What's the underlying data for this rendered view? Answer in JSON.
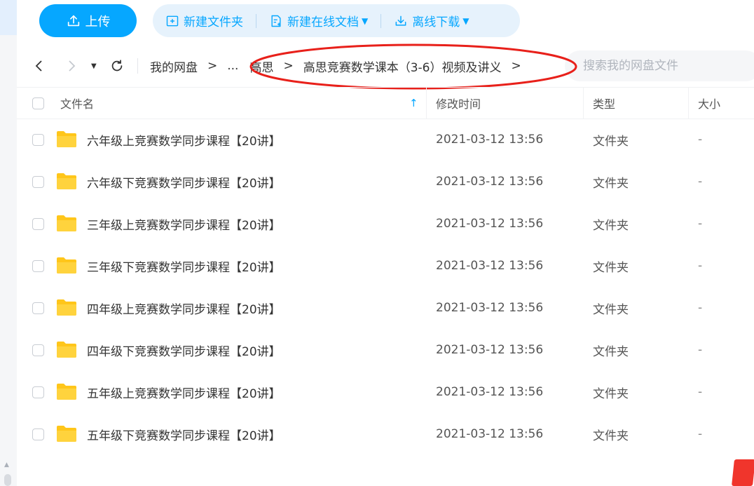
{
  "toolbar": {
    "upload_label": "上传",
    "new_folder_label": "新建文件夹",
    "new_doc_label": "新建在线文档",
    "offline_download_label": "离线下载",
    "caret": "▼"
  },
  "nav": {
    "history_caret": "▼",
    "breadcrumbs": [
      "我的网盘",
      "...",
      "高思",
      "高思竞赛数学课本（3-6）视频及讲义"
    ],
    "separator": ">"
  },
  "search": {
    "placeholder": "搜索我的网盘文件"
  },
  "table": {
    "headers": {
      "name": "文件名",
      "modified": "修改时间",
      "type": "类型",
      "size": "大小"
    },
    "sort_indicator": "↑",
    "rows": [
      {
        "name": "六年级上竞赛数学同步课程【20讲】",
        "modified": "2021-03-12 13:56",
        "type": "文件夹",
        "size": "-"
      },
      {
        "name": "六年级下竞赛数学同步课程【20讲】",
        "modified": "2021-03-12 13:56",
        "type": "文件夹",
        "size": "-"
      },
      {
        "name": "三年级上竞赛数学同步课程【20讲】",
        "modified": "2021-03-12 13:56",
        "type": "文件夹",
        "size": "-"
      },
      {
        "name": "三年级下竞赛数学同步课程【20讲】",
        "modified": "2021-03-12 13:56",
        "type": "文件夹",
        "size": "-"
      },
      {
        "name": "四年级上竞赛数学同步课程【20讲】",
        "modified": "2021-03-12 13:56",
        "type": "文件夹",
        "size": "-"
      },
      {
        "name": "四年级下竞赛数学同步课程【20讲】",
        "modified": "2021-03-12 13:56",
        "type": "文件夹",
        "size": "-"
      },
      {
        "name": "五年级上竞赛数学同步课程【20讲】",
        "modified": "2021-03-12 13:56",
        "type": "文件夹",
        "size": "-"
      },
      {
        "name": "五年级下竞赛数学同步课程【20讲】",
        "modified": "2021-03-12 13:56",
        "type": "文件夹",
        "size": "-"
      }
    ]
  },
  "colors": {
    "accent": "#06a7ff",
    "folder": "#ffc61a",
    "annotation": "#e8201a"
  },
  "icons": [
    "upload-icon",
    "new-folder-icon",
    "new-doc-icon",
    "download-icon",
    "back-icon",
    "forward-icon",
    "refresh-icon",
    "folder-icon"
  ]
}
